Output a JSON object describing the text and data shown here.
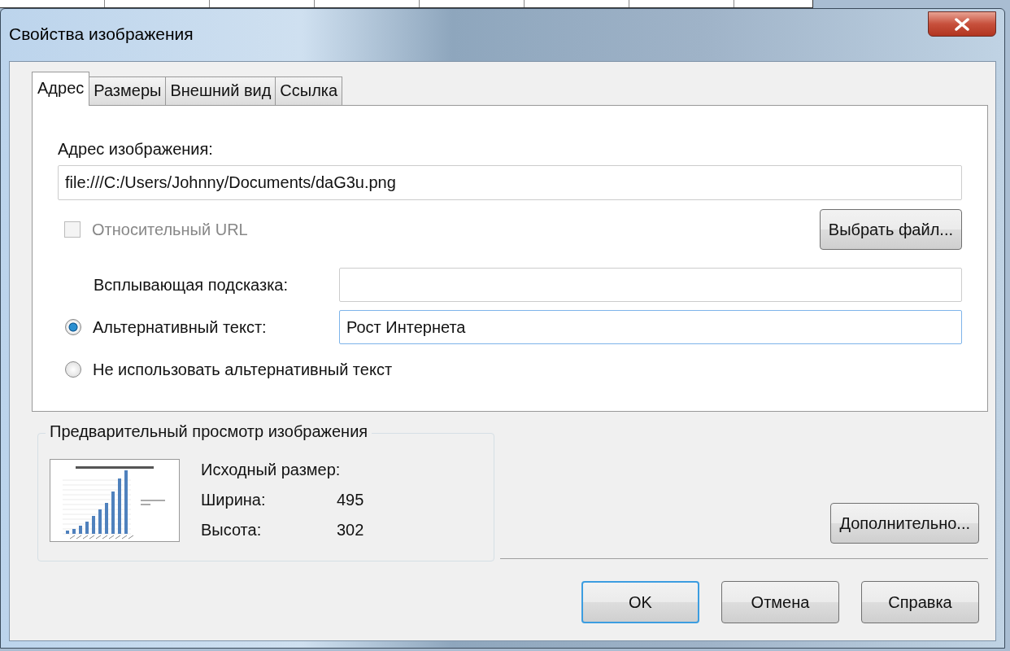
{
  "window": {
    "title": "Свойства изображения"
  },
  "tabs": [
    {
      "label": "Адрес",
      "selected": true
    },
    {
      "label": "Размеры",
      "selected": false
    },
    {
      "label": "Внешний вид",
      "selected": false
    },
    {
      "label": "Ссылка",
      "selected": false
    }
  ],
  "address": {
    "label": "Адрес изображения:",
    "value": "file:///C:/Users/Johnny/Documents/daG3u.png"
  },
  "relative_url": {
    "label": "Относительный URL",
    "checked": false,
    "disabled": true
  },
  "choose_file_button": "Выбрать файл...",
  "tooltip": {
    "label": "Всплывающая подсказка:"
  },
  "alt_options": [
    {
      "label": "Альтернативный текст:",
      "selected": true,
      "value": "Рост Интернета"
    },
    {
      "label": "Не использовать альтернативный текст",
      "selected": false
    }
  ],
  "preview": {
    "title": "Предварительный просмотр изображения",
    "size_label": "Исходный размер:",
    "rows": [
      {
        "label": "Ширина:",
        "value": "495"
      },
      {
        "label": "Высота:",
        "value": "302"
      }
    ]
  },
  "advanced_button": "Дополнительно...",
  "buttons": [
    {
      "label": "OK",
      "default": true
    },
    {
      "label": "Отмена",
      "default": false
    },
    {
      "label": "Справка",
      "default": false
    }
  ]
}
